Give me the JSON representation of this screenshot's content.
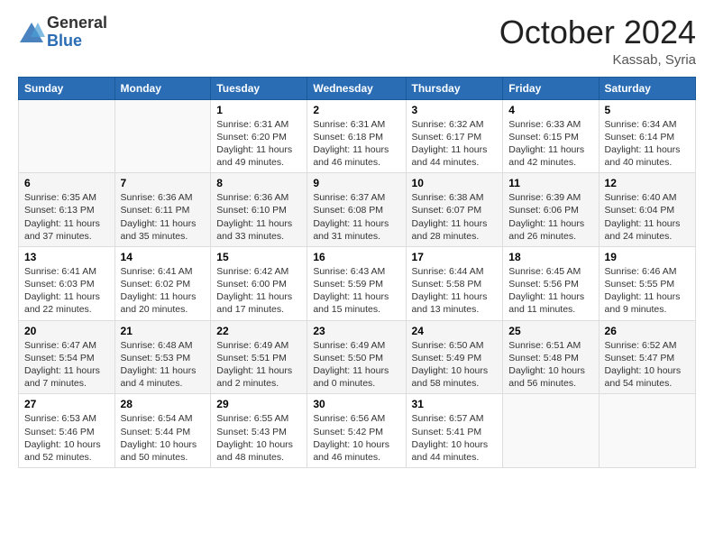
{
  "logo": {
    "general": "General",
    "blue": "Blue"
  },
  "header": {
    "month": "October 2024",
    "location": "Kassab, Syria"
  },
  "weekdays": [
    "Sunday",
    "Monday",
    "Tuesday",
    "Wednesday",
    "Thursday",
    "Friday",
    "Saturday"
  ],
  "weeks": [
    [
      {
        "day": "",
        "sunrise": "",
        "sunset": "",
        "daylight": ""
      },
      {
        "day": "",
        "sunrise": "",
        "sunset": "",
        "daylight": ""
      },
      {
        "day": "1",
        "sunrise": "Sunrise: 6:31 AM",
        "sunset": "Sunset: 6:20 PM",
        "daylight": "Daylight: 11 hours and 49 minutes."
      },
      {
        "day": "2",
        "sunrise": "Sunrise: 6:31 AM",
        "sunset": "Sunset: 6:18 PM",
        "daylight": "Daylight: 11 hours and 46 minutes."
      },
      {
        "day": "3",
        "sunrise": "Sunrise: 6:32 AM",
        "sunset": "Sunset: 6:17 PM",
        "daylight": "Daylight: 11 hours and 44 minutes."
      },
      {
        "day": "4",
        "sunrise": "Sunrise: 6:33 AM",
        "sunset": "Sunset: 6:15 PM",
        "daylight": "Daylight: 11 hours and 42 minutes."
      },
      {
        "day": "5",
        "sunrise": "Sunrise: 6:34 AM",
        "sunset": "Sunset: 6:14 PM",
        "daylight": "Daylight: 11 hours and 40 minutes."
      }
    ],
    [
      {
        "day": "6",
        "sunrise": "Sunrise: 6:35 AM",
        "sunset": "Sunset: 6:13 PM",
        "daylight": "Daylight: 11 hours and 37 minutes."
      },
      {
        "day": "7",
        "sunrise": "Sunrise: 6:36 AM",
        "sunset": "Sunset: 6:11 PM",
        "daylight": "Daylight: 11 hours and 35 minutes."
      },
      {
        "day": "8",
        "sunrise": "Sunrise: 6:36 AM",
        "sunset": "Sunset: 6:10 PM",
        "daylight": "Daylight: 11 hours and 33 minutes."
      },
      {
        "day": "9",
        "sunrise": "Sunrise: 6:37 AM",
        "sunset": "Sunset: 6:08 PM",
        "daylight": "Daylight: 11 hours and 31 minutes."
      },
      {
        "day": "10",
        "sunrise": "Sunrise: 6:38 AM",
        "sunset": "Sunset: 6:07 PM",
        "daylight": "Daylight: 11 hours and 28 minutes."
      },
      {
        "day": "11",
        "sunrise": "Sunrise: 6:39 AM",
        "sunset": "Sunset: 6:06 PM",
        "daylight": "Daylight: 11 hours and 26 minutes."
      },
      {
        "day": "12",
        "sunrise": "Sunrise: 6:40 AM",
        "sunset": "Sunset: 6:04 PM",
        "daylight": "Daylight: 11 hours and 24 minutes."
      }
    ],
    [
      {
        "day": "13",
        "sunrise": "Sunrise: 6:41 AM",
        "sunset": "Sunset: 6:03 PM",
        "daylight": "Daylight: 11 hours and 22 minutes."
      },
      {
        "day": "14",
        "sunrise": "Sunrise: 6:41 AM",
        "sunset": "Sunset: 6:02 PM",
        "daylight": "Daylight: 11 hours and 20 minutes."
      },
      {
        "day": "15",
        "sunrise": "Sunrise: 6:42 AM",
        "sunset": "Sunset: 6:00 PM",
        "daylight": "Daylight: 11 hours and 17 minutes."
      },
      {
        "day": "16",
        "sunrise": "Sunrise: 6:43 AM",
        "sunset": "Sunset: 5:59 PM",
        "daylight": "Daylight: 11 hours and 15 minutes."
      },
      {
        "day": "17",
        "sunrise": "Sunrise: 6:44 AM",
        "sunset": "Sunset: 5:58 PM",
        "daylight": "Daylight: 11 hours and 13 minutes."
      },
      {
        "day": "18",
        "sunrise": "Sunrise: 6:45 AM",
        "sunset": "Sunset: 5:56 PM",
        "daylight": "Daylight: 11 hours and 11 minutes."
      },
      {
        "day": "19",
        "sunrise": "Sunrise: 6:46 AM",
        "sunset": "Sunset: 5:55 PM",
        "daylight": "Daylight: 11 hours and 9 minutes."
      }
    ],
    [
      {
        "day": "20",
        "sunrise": "Sunrise: 6:47 AM",
        "sunset": "Sunset: 5:54 PM",
        "daylight": "Daylight: 11 hours and 7 minutes."
      },
      {
        "day": "21",
        "sunrise": "Sunrise: 6:48 AM",
        "sunset": "Sunset: 5:53 PM",
        "daylight": "Daylight: 11 hours and 4 minutes."
      },
      {
        "day": "22",
        "sunrise": "Sunrise: 6:49 AM",
        "sunset": "Sunset: 5:51 PM",
        "daylight": "Daylight: 11 hours and 2 minutes."
      },
      {
        "day": "23",
        "sunrise": "Sunrise: 6:49 AM",
        "sunset": "Sunset: 5:50 PM",
        "daylight": "Daylight: 11 hours and 0 minutes."
      },
      {
        "day": "24",
        "sunrise": "Sunrise: 6:50 AM",
        "sunset": "Sunset: 5:49 PM",
        "daylight": "Daylight: 10 hours and 58 minutes."
      },
      {
        "day": "25",
        "sunrise": "Sunrise: 6:51 AM",
        "sunset": "Sunset: 5:48 PM",
        "daylight": "Daylight: 10 hours and 56 minutes."
      },
      {
        "day": "26",
        "sunrise": "Sunrise: 6:52 AM",
        "sunset": "Sunset: 5:47 PM",
        "daylight": "Daylight: 10 hours and 54 minutes."
      }
    ],
    [
      {
        "day": "27",
        "sunrise": "Sunrise: 6:53 AM",
        "sunset": "Sunset: 5:46 PM",
        "daylight": "Daylight: 10 hours and 52 minutes."
      },
      {
        "day": "28",
        "sunrise": "Sunrise: 6:54 AM",
        "sunset": "Sunset: 5:44 PM",
        "daylight": "Daylight: 10 hours and 50 minutes."
      },
      {
        "day": "29",
        "sunrise": "Sunrise: 6:55 AM",
        "sunset": "Sunset: 5:43 PM",
        "daylight": "Daylight: 10 hours and 48 minutes."
      },
      {
        "day": "30",
        "sunrise": "Sunrise: 6:56 AM",
        "sunset": "Sunset: 5:42 PM",
        "daylight": "Daylight: 10 hours and 46 minutes."
      },
      {
        "day": "31",
        "sunrise": "Sunrise: 6:57 AM",
        "sunset": "Sunset: 5:41 PM",
        "daylight": "Daylight: 10 hours and 44 minutes."
      },
      {
        "day": "",
        "sunrise": "",
        "sunset": "",
        "daylight": ""
      },
      {
        "day": "",
        "sunrise": "",
        "sunset": "",
        "daylight": ""
      }
    ]
  ]
}
